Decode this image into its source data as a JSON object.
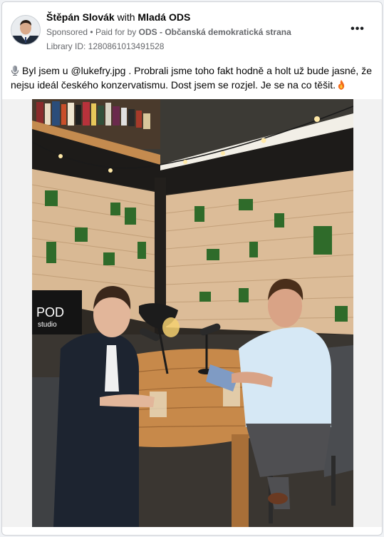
{
  "header": {
    "page_name": "Štěpán Slovák",
    "with_word": "with",
    "partner_name": "Mladá ODS",
    "sponsored": "Sponsored",
    "paid_for_by_label": "Paid for by",
    "payer": "ODS - Občanská demokratická strana",
    "library_id": "Library ID: 1280861013491528",
    "more_icon": "more-dots-icon"
  },
  "post": {
    "text": "Byl jsem u @lukefry.jpg . Probrali jsme toho fakt hodně a holt už bude jasné, že nejsu ideál českého konzervatismu. Dost jsem se rozjel. Je se na co těšit.",
    "leading_icon": "microphone-icon",
    "trailing_icon": "fire-icon"
  },
  "media": {
    "photo_sign_text": "POD",
    "photo_sign_sub": "studio"
  },
  "colors": {
    "text_primary": "#050505",
    "text_secondary": "#65676b",
    "card_bg": "#ffffff",
    "page_bg": "#f0f2f5"
  }
}
